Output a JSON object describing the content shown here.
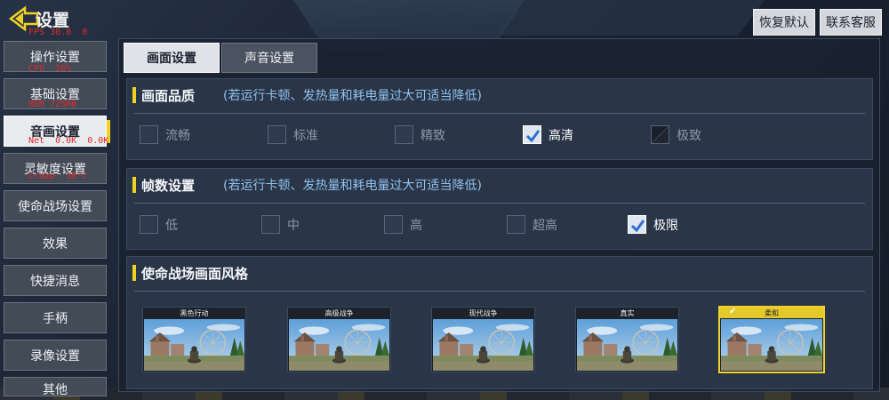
{
  "perf": {
    "lines": [
      "FPS 30.0  0",
      "CPU  26%",
      "MEM 725MB",
      "Net  0.0K  0.0K",
      "Cramp  38°C"
    ]
  },
  "header": {
    "title": "设置",
    "restore_label": "恢复默认",
    "support_label": "联系客服"
  },
  "sidebar": {
    "items": [
      {
        "label": "操作设置"
      },
      {
        "label": "基础设置"
      },
      {
        "label": "音画设置"
      },
      {
        "label": "灵敏度设置"
      },
      {
        "label": "使命战场设置"
      },
      {
        "label": "效果"
      },
      {
        "label": "快捷消息"
      },
      {
        "label": "手柄"
      },
      {
        "label": "录像设置"
      },
      {
        "label": "其他"
      }
    ],
    "active_index": 2
  },
  "tabs": [
    {
      "label": "画面设置",
      "active": true
    },
    {
      "label": "声音设置",
      "active": false
    }
  ],
  "quality": {
    "title": "画面品质",
    "hint": "(若运行卡顿、发热量和耗电量过大可适当降低)",
    "options": [
      {
        "label": "流畅",
        "state": "unchecked"
      },
      {
        "label": "标准",
        "state": "unchecked"
      },
      {
        "label": "精致",
        "state": "unchecked"
      },
      {
        "label": "高清",
        "state": "checked"
      },
      {
        "label": "极致",
        "state": "disabled"
      }
    ]
  },
  "framerate": {
    "title": "帧数设置",
    "hint": "(若运行卡顿、发热量和耗电量过大可适当降低)",
    "options": [
      {
        "label": "低",
        "state": "unchecked"
      },
      {
        "label": "中",
        "state": "unchecked"
      },
      {
        "label": "高",
        "state": "unchecked"
      },
      {
        "label": "超高",
        "state": "unchecked"
      },
      {
        "label": "极限",
        "state": "checked"
      }
    ]
  },
  "style": {
    "title": "使命战场画面风格",
    "cards": [
      {
        "label": "黑色行动",
        "selected": false
      },
      {
        "label": "高级战争",
        "selected": false
      },
      {
        "label": "现代战争",
        "selected": false
      },
      {
        "label": "真实",
        "selected": false
      },
      {
        "label": "柔和",
        "selected": true
      }
    ]
  },
  "colors": {
    "accent": "#f2d125",
    "hint": "#8fc1ec"
  }
}
